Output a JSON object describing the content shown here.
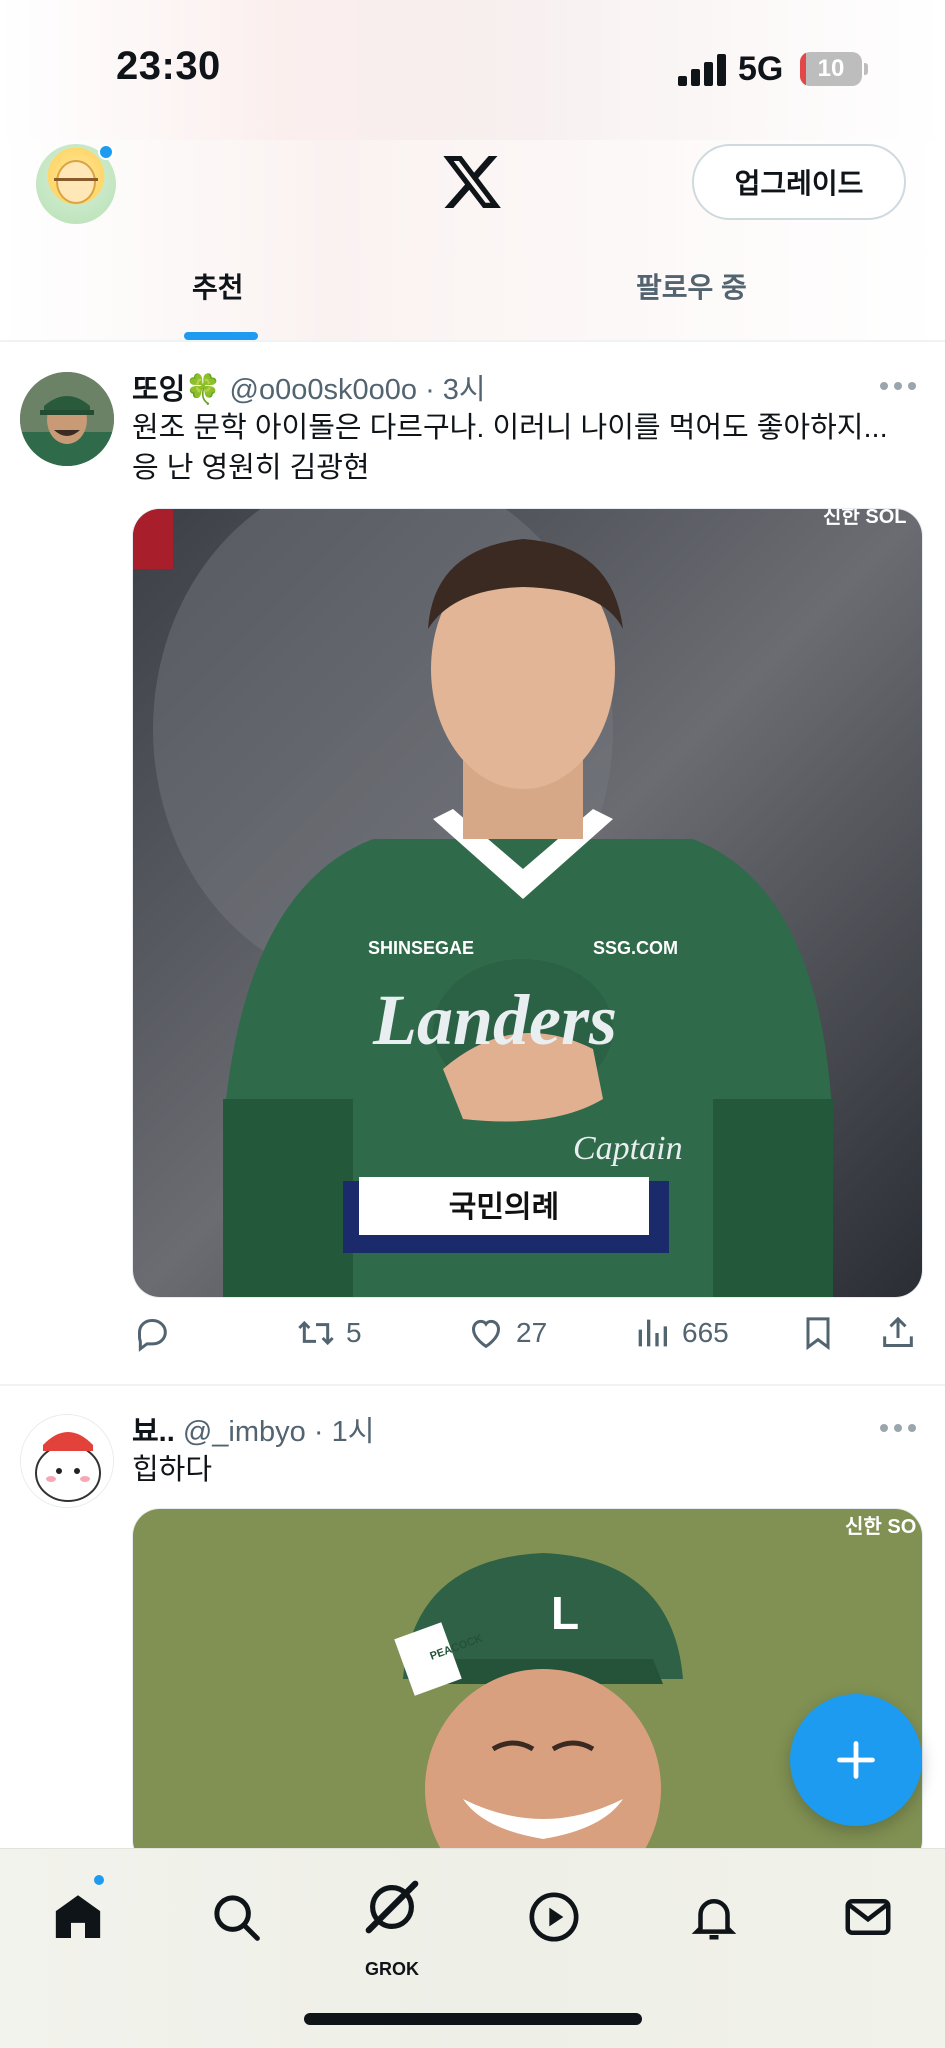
{
  "status_bar": {
    "time": "23:30",
    "network": "5G",
    "battery": "10",
    "battery_fraction": 0.1
  },
  "header": {
    "upgrade_label": "업그레이드"
  },
  "tabs": [
    {
      "label": "추천",
      "active": true
    },
    {
      "label": "팔로우 중",
      "active": false
    }
  ],
  "tweets": [
    {
      "name": "또잉🍀",
      "handle": "@o0o0sk0o0o",
      "time": "· 3시",
      "text_lines": [
        "원조 문학 아이돌은 다르구나. 이러니 나이를 먹어도 좋아하지...",
        "응 난 영원히 김광현"
      ],
      "media_caption": "국민의례",
      "media_texts": {
        "sponsor_left": "SHINSEGAE",
        "sponsor_right": "SSG.COM",
        "team": "Landers",
        "captain": "Captain",
        "broadcaster": "신한 SOL"
      },
      "actions": {
        "retweets": "5",
        "likes": "27",
        "views": "665"
      }
    },
    {
      "name": "뵤..",
      "handle": "@_imbyo",
      "time": "· 1시",
      "text_lines": [
        "힙하다"
      ],
      "media_texts": {
        "broadcaster": "신한 SO",
        "cap_text": "PEACOCK"
      }
    }
  ],
  "bottom_nav": {
    "grok_label": "GROK"
  },
  "colors": {
    "accent": "#1d9bf0",
    "jersey_green": "#2f6b4a",
    "text": "#0f1419",
    "muted": "#536471"
  },
  "icons": [
    "x-logo-icon",
    "more-icon",
    "reply-icon",
    "retweet-icon",
    "like-icon",
    "views-icon",
    "bookmark-icon",
    "share-icon",
    "plus-icon",
    "home-icon",
    "search-icon",
    "grok-icon",
    "play-icon",
    "bell-icon",
    "mail-icon"
  ]
}
